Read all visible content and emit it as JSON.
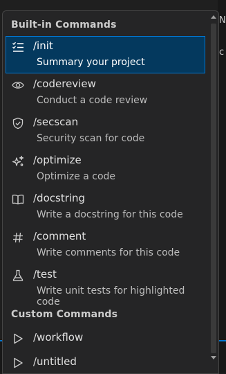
{
  "background": {
    "right_glyph_top": "N",
    "right_glyph_mid": "c"
  },
  "popup": {
    "builtin_header": "Built-in Commands",
    "custom_header": "Custom Commands",
    "builtin_items": [
      {
        "command": "/init",
        "description": "Summary your project",
        "icon": "checklist-icon",
        "selected": true
      },
      {
        "command": "/codereview",
        "description": "Conduct a code review",
        "icon": "eye-icon"
      },
      {
        "command": "/secscan",
        "description": "Security scan for code",
        "icon": "shield-check-icon"
      },
      {
        "command": "/optimize",
        "description": "Optimize a code",
        "icon": "sparkle-icon"
      },
      {
        "command": "/docstring",
        "description": "Write a docstring for this code",
        "icon": "book-icon"
      },
      {
        "command": "/comment",
        "description": "Write comments for this code",
        "icon": "hash-icon"
      },
      {
        "command": "/test",
        "description": "Write unit tests for highlighted code",
        "icon": "beaker-icon"
      }
    ],
    "custom_items": [
      {
        "command": "/workflow",
        "icon": "play-icon"
      },
      {
        "command": "/untitled",
        "icon": "play-icon"
      }
    ]
  },
  "colors": {
    "selected_bg": "#04395e",
    "accent": "#0078d4",
    "popup_bg": "#252526"
  }
}
